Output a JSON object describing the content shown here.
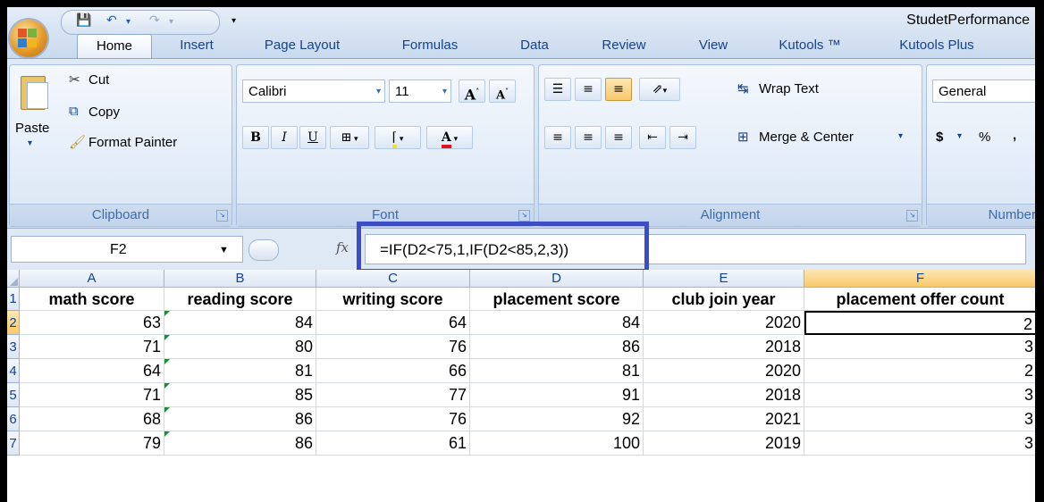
{
  "window": {
    "title": "StudetPerformance"
  },
  "tabs": [
    "Home",
    "Insert",
    "Page Layout",
    "Formulas",
    "Data",
    "Review",
    "View",
    "Kutools ™",
    "Kutools Plus"
  ],
  "clipboard": {
    "paste": "Paste",
    "cut": "Cut",
    "copy": "Copy",
    "format_painter": "Format Painter",
    "label": "Clipboard"
  },
  "font": {
    "name": "Calibri",
    "size": "11",
    "label": "Font",
    "bold": "B",
    "italic": "I",
    "underline": "U",
    "grow": "A",
    "shrink": "A"
  },
  "alignment": {
    "wrap_text": "Wrap Text",
    "merge_center": "Merge & Center",
    "label": "Alignment"
  },
  "number": {
    "format": "General",
    "label": "Number",
    "currency": "$",
    "percent": "%",
    "comma": ","
  },
  "formula_bar": {
    "name_box": "F2",
    "fx": "fx",
    "formula": "=IF(D2<75,1,IF(D2<85,2,3))"
  },
  "sheet": {
    "columns": [
      "A",
      "B",
      "C",
      "D",
      "E",
      "F"
    ],
    "rows": [
      "1",
      "2",
      "3",
      "4",
      "5",
      "6",
      "7"
    ],
    "headers": [
      "math score",
      "reading score",
      "writing score",
      "placement score",
      "club join year",
      "placement offer count"
    ],
    "data": [
      [
        "63",
        "84",
        "64",
        "84",
        "2020",
        "2"
      ],
      [
        "71",
        "80",
        "76",
        "86",
        "2018",
        "3"
      ],
      [
        "64",
        "81",
        "66",
        "81",
        "2020",
        "2"
      ],
      [
        "71",
        "85",
        "77",
        "91",
        "2018",
        "3"
      ],
      [
        "68",
        "86",
        "76",
        "92",
        "2021",
        "3"
      ],
      [
        "79",
        "86",
        "61",
        "100",
        "2019",
        "3"
      ]
    ]
  },
  "colors": {
    "highlight_box": "#3c4cc4",
    "selected_header": "#f8c96b",
    "error_indicator": "#1e8a33"
  }
}
